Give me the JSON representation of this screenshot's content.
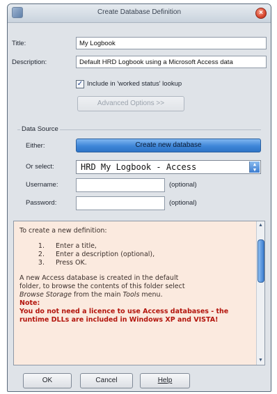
{
  "window": {
    "title": "Create Database Definition",
    "close_glyph": "×"
  },
  "form": {
    "title_label": "Title:",
    "title_value": "My Logbook",
    "description_label": "Description:",
    "description_value": "Default HRD Logbook using a Microsoft Access data",
    "include_label": "Include in 'worked status' lookup",
    "include_checked": true,
    "advanced_button": "Advanced Options >>"
  },
  "data_source": {
    "group_label": "Data Source",
    "either_label": "Either:",
    "create_button": "Create new database",
    "or_select_label": "Or select:",
    "selected_value": "HRD My Logbook - Access",
    "username_label": "Username:",
    "username_value": "",
    "username_hint": "(optional)",
    "password_label": "Password:",
    "password_value": "",
    "password_hint": "(optional)"
  },
  "info": {
    "intro": "To create a new definition:",
    "steps": [
      {
        "num": "1.",
        "text": "Enter a title,"
      },
      {
        "num": "2.",
        "text": "Enter a description (optional),"
      },
      {
        "num": "3.",
        "text": "Press OK."
      }
    ],
    "para_line1": "A new Access database is created in the default",
    "para_line2": "folder, to browse the contents of this folder select",
    "para_italic1": "Browse Storage",
    "para_mid": "from the main",
    "para_italic2": "Tools",
    "para_end": "menu.",
    "note_title": "Note:",
    "note_text": "You do not need a licence to use Access databases - the runtime DLLs are included in Windows XP and VISTA!"
  },
  "footer": {
    "ok": "OK",
    "cancel": "Cancel",
    "help": "Help"
  },
  "icons": {
    "app": "app-icon",
    "close": "close-icon",
    "dropdown": "chevron-down-icon",
    "scroll_up": "scroll-up-icon",
    "scroll_down": "scroll-down-icon"
  }
}
